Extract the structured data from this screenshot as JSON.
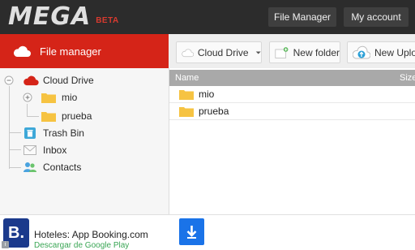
{
  "app": {
    "logo": "MEGA",
    "beta": "BETA"
  },
  "topnav": {
    "file_manager": "File Manager",
    "my_account": "My account"
  },
  "sidebar": {
    "header": "File manager",
    "tree": {
      "root": "Cloud Drive",
      "folders": [
        "mio",
        "prueba"
      ],
      "trash": "Trash Bin",
      "inbox": "Inbox",
      "contacts": "Contacts"
    }
  },
  "toolbar": {
    "location": "Cloud Drive",
    "new_folder": "New folder",
    "new_upload": "New Upload"
  },
  "list": {
    "columns": {
      "name": "Name",
      "size": "Size"
    },
    "rows": [
      {
        "name": "mio"
      },
      {
        "name": "prueba"
      }
    ]
  },
  "ad": {
    "logo_letter": "B.",
    "title": "Hoteles: App Booking.com",
    "subtitle": "Descargar de Google Play",
    "info": "i"
  },
  "colors": {
    "topbar": "#2c2c2c",
    "accent_red": "#d52418",
    "folder": "#f6c342",
    "column_header": "#a9a9a9",
    "download_blue": "#1a73e8",
    "booking_blue": "#1b3a8c"
  }
}
